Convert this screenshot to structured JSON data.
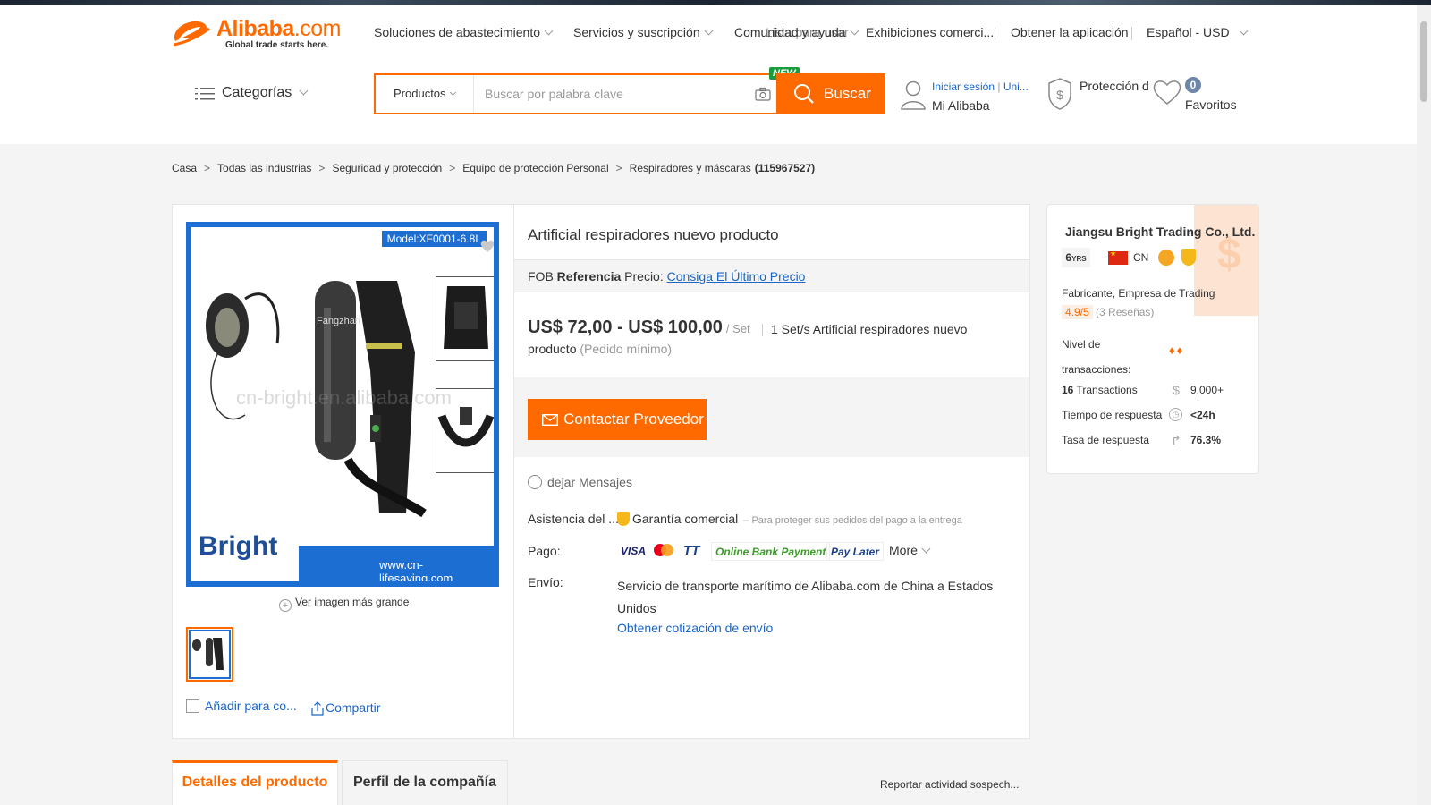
{
  "header": {
    "logo_word": "Alibaba",
    "logo_tld": ".com",
    "logo_slogan": "Global trade starts here.",
    "nav": {
      "sourcing": "Soluciones de abastecimiento",
      "services": "Servicios y suscripción",
      "community": "Comunidad y ayuda",
      "community_overlap": "Lista para usar",
      "exhibitions": "Exhibiciones comerci...",
      "app": "Obtener la aplicación",
      "language": "Español - USD"
    },
    "categories_label": "Categorías",
    "search": {
      "category": "Productos",
      "placeholder": "Buscar por palabra clave",
      "new_badge": "NEW",
      "button": "Buscar"
    },
    "account": {
      "signin": "Iniciar sesión",
      "join": "Uni...",
      "my_alibaba": "Mi Alibaba"
    },
    "protection_label": "Protección d",
    "favorites_count": "0",
    "favorites_label": "Favoritos"
  },
  "breadcrumb": {
    "items": [
      "Casa",
      "Todas las industrias",
      "Seguridad y protección",
      "Equipo de protección Personal",
      "Respiradores y máscaras"
    ],
    "count": "(115967527)"
  },
  "gallery": {
    "model_label": "Model:XF0001-6.8L",
    "watermark": "cn-bright.en.alibaba.com",
    "brand": "Bright",
    "url": "www.cn-lifesaving.com",
    "enlarge": "Ver imagen más grande",
    "compare": "Añadir para co...",
    "share": "Compartir"
  },
  "product": {
    "title": "Artificial respiradores nuevo producto",
    "fob_prefix": "FOB",
    "fob_ref": "Referencia",
    "fob_price": "Precio:",
    "fob_link": "Consiga El Último Precio",
    "price_range": "US$ 72,00 - US$ 100,00",
    "price_unit": "/ Set",
    "moq_line1": "1 Set/s Artificial respiradores nuevo",
    "moq_line2": "producto",
    "moq_note": "(Pedido mínimo)",
    "contact_button": "Contactar Proveedor",
    "leave_message": "dejar Mensajes",
    "assist_label": "Asistencia del ...",
    "assurance_label": "Garantía comercial",
    "assurance_note": "– Para proteger sus pedidos del pago a la entrega",
    "payment_label": "Pago:",
    "payment_methods": {
      "visa": "VISA",
      "tt": "TT",
      "online_bank": "Online Bank Payment",
      "pay_later": "Pay Later",
      "more": "More"
    },
    "shipping_label": "Envío:",
    "shipping_text": "Servicio de transporte marítimo de Alibaba.com de China a Estados Unidos",
    "shipping_quote": "Obtener cotización de envío"
  },
  "supplier": {
    "name": "Jiangsu Bright Trading Co., Ltd.",
    "years": "6",
    "years_suffix": "YRS",
    "country": "CN",
    "type": "Fabricante, Empresa de Trading",
    "rating": "4.9/5",
    "reviews": "(3 Reseñas)",
    "tx_level_label": "Nivel de transacciones:",
    "tx_count": "16",
    "tx_label": "Transactions",
    "tx_value": "9,000+",
    "response_time_label": "Tiempo de respuesta",
    "response_time_value": "<24h",
    "response_rate_label": "Tasa de respuesta",
    "response_rate_value": "76.3%"
  },
  "tabs": {
    "details": "Detalles del producto",
    "profile": "Perfil de la compañía"
  },
  "report": "Reportar actividad sospech...",
  "colors": {
    "brand_orange": "#ff6a00",
    "link_blue": "#1a66c9",
    "image_blue": "#1d6ed3"
  }
}
